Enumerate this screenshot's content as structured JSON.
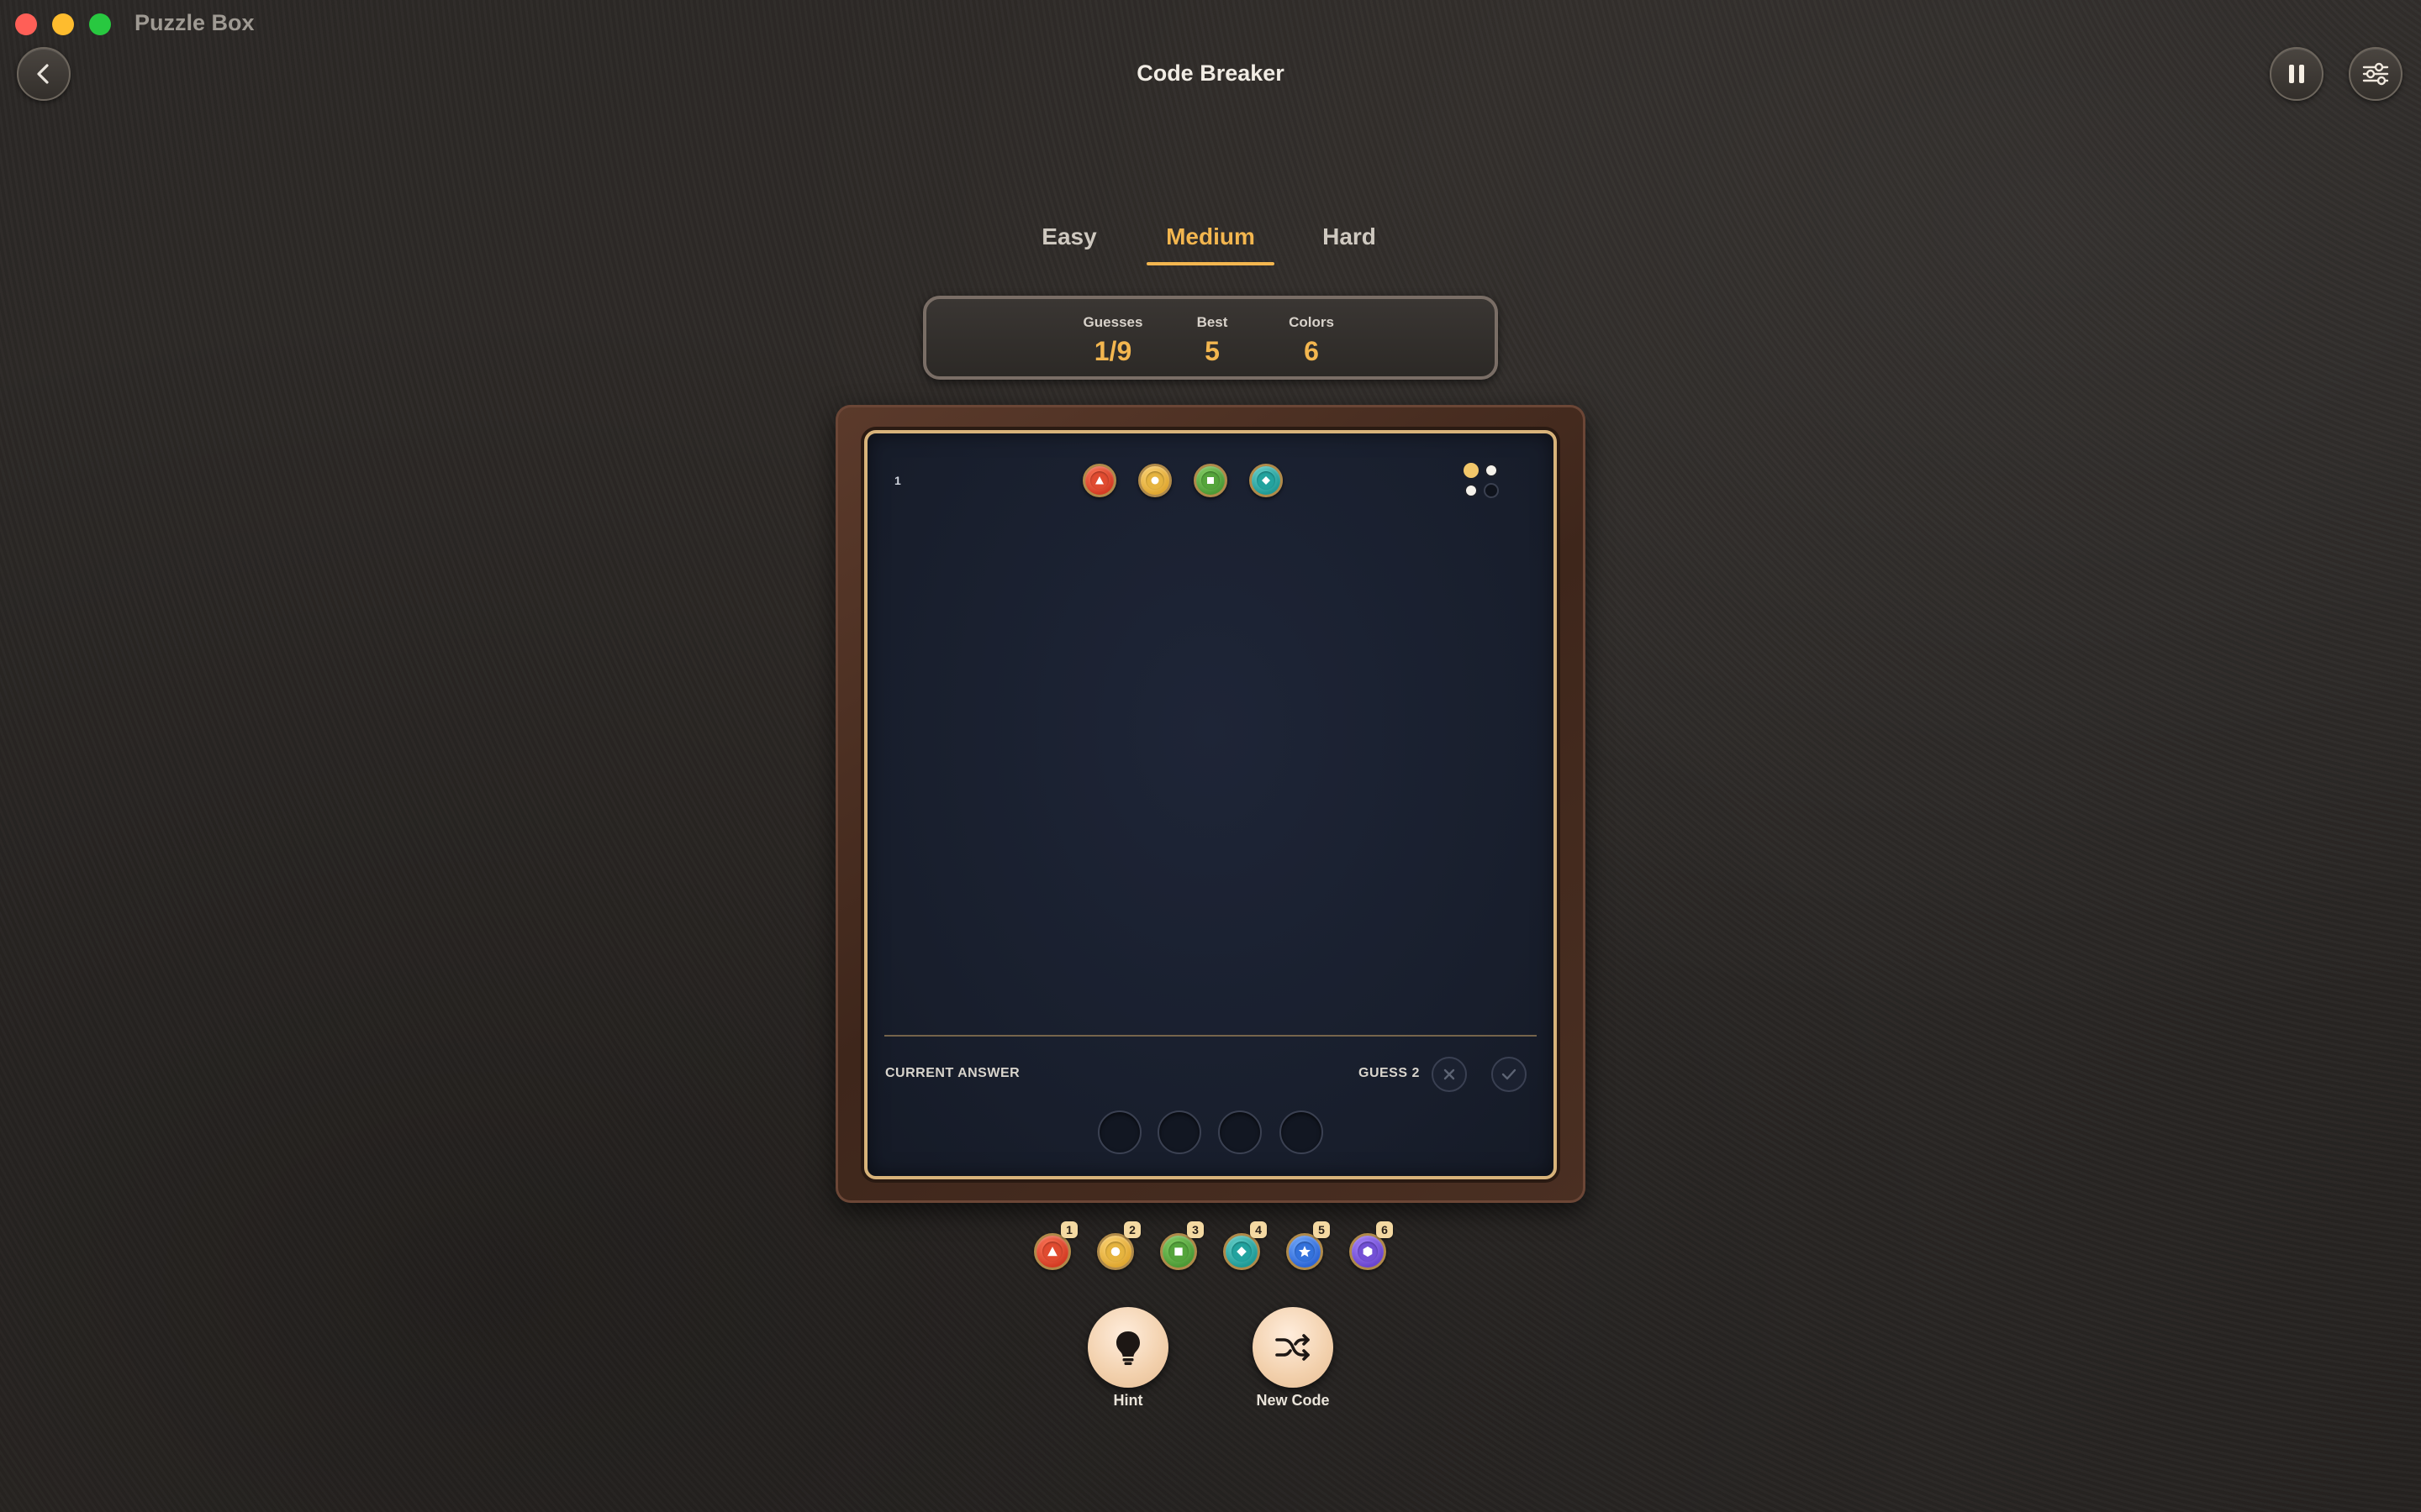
{
  "window": {
    "app_title": "Puzzle Box",
    "page_title": "Code Breaker"
  },
  "toolbar": {
    "back_icon": "chevron-left-icon",
    "pause_icon": "pause-icon",
    "settings_icon": "sliders-icon"
  },
  "difficulty": {
    "tabs": [
      {
        "label": "Easy",
        "selected": false
      },
      {
        "label": "Medium",
        "selected": true
      },
      {
        "label": "Hard",
        "selected": false
      }
    ],
    "accent_color": "#f3b64f"
  },
  "stats": {
    "guesses_label": "Guesses",
    "guesses_value": "1/9",
    "best_label": "Best",
    "best_value": "5",
    "colors_label": "Colors",
    "colors_value": "6"
  },
  "board": {
    "rows": [
      {
        "number": "1",
        "pegs": [
          "red-triangle",
          "yellow-circle",
          "green-square",
          "teal-diamond"
        ],
        "feedback": [
          "hit",
          "near",
          "near",
          "empty"
        ]
      }
    ],
    "current_answer_label": "CURRENT ANSWER",
    "guess_label": "GUESS 2",
    "clear_icon": "close-icon",
    "submit_icon": "check-icon",
    "answer_slots": [
      "",
      "",
      "",
      ""
    ]
  },
  "palette": [
    {
      "key": "1",
      "color": "red",
      "symbol": "triangle-icon"
    },
    {
      "key": "2",
      "color": "yellow",
      "symbol": "circle-icon"
    },
    {
      "key": "3",
      "color": "green",
      "symbol": "square-icon"
    },
    {
      "key": "4",
      "color": "teal",
      "symbol": "diamond-icon"
    },
    {
      "key": "5",
      "color": "blue",
      "symbol": "star-icon"
    },
    {
      "key": "6",
      "color": "purple",
      "symbol": "hexagon-icon"
    }
  ],
  "actions": {
    "hint_label": "Hint",
    "hint_icon": "lightbulb-icon",
    "new_code_label": "New Code",
    "new_code_icon": "shuffle-icon"
  }
}
